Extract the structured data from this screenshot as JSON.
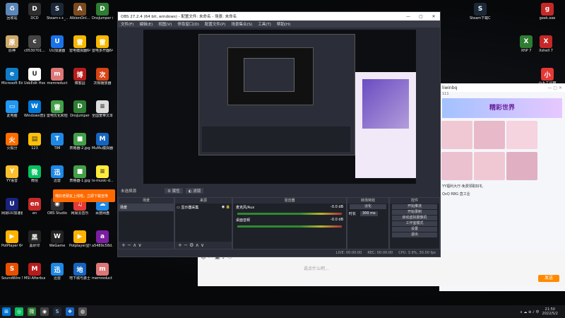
{
  "desktop_icons": [
    {
      "label": "回收站",
      "color": "#5b86b8",
      "glyph": "♻"
    },
    {
      "label": "DCD",
      "color": "#2e2e2e",
      "glyph": "D"
    },
    {
      "label": "Steam++_...",
      "color": "#1b2838",
      "glyph": "S"
    },
    {
      "label": "AlbionOnl...",
      "color": "#7a4a20",
      "glyph": "A"
    },
    {
      "label": "DnsJumper (2)7z",
      "color": "#2e7d32",
      "glyph": "D"
    },
    {
      "label": "原神",
      "color": "#cfa96a",
      "glyph": "原"
    },
    {
      "label": "c0530701...",
      "color": "#444",
      "glyph": "c"
    },
    {
      "label": "UU加速器",
      "color": "#1a73e8",
      "glyph": "U"
    },
    {
      "label": "雷电模拟器64",
      "color": "#f5b800",
      "glyph": "雷"
    },
    {
      "label": "雷电多开器64",
      "color": "#f5b800",
      "glyph": "雷"
    },
    {
      "label": "Microsoft Edge",
      "color": "#0f7cc9",
      "glyph": "e"
    },
    {
      "label": "UsbEdit Hosts Editor",
      "color": "#fff",
      "glyph": "U"
    },
    {
      "label": "memreduct",
      "color": "#d77",
      "glyph": "m"
    },
    {
      "label": "博客园",
      "color": "#b71c1c",
      "glyph": "博"
    },
    {
      "label": "次频播放器",
      "color": "#d84315",
      "glyph": "次"
    },
    {
      "label": "此电脑",
      "color": "#2196f3",
      "glyph": "▭"
    },
    {
      "label": "Windows普通网络调整",
      "color": "#0078d7",
      "glyph": "W"
    },
    {
      "label": "雷电优化和检测",
      "color": "#43a047",
      "glyph": "雷"
    },
    {
      "label": "DnsJumper",
      "color": "#2e7d32",
      "glyph": "D"
    },
    {
      "label": "全国宽带文本txt",
      "color": "#ddd",
      "glyph": "≡"
    },
    {
      "label": "火狐分",
      "color": "#ff6d00",
      "glyph": "火"
    },
    {
      "label": "123",
      "color": "#ffc107",
      "glyph": "▤"
    },
    {
      "label": "TIM",
      "color": "#1e88e5",
      "glyph": "T"
    },
    {
      "label": "表格器-2.jpg",
      "color": "#43a047",
      "glyph": "■"
    },
    {
      "label": "MuMu模拟器",
      "color": "#1565c0",
      "glyph": "M"
    },
    {
      "label": "YY语音",
      "color": "#fbc02d",
      "glyph": "Y"
    },
    {
      "label": "微信",
      "color": "#07c160",
      "glyph": "微"
    },
    {
      "label": "迅雷",
      "color": "#1e88e5",
      "glyph": "迅"
    },
    {
      "label": "表格器-1.jpg",
      "color": "#43a047",
      "glyph": "■"
    },
    {
      "label": "lx-music-d...",
      "color": "#ffeb3b",
      "glyph": "≡"
    },
    {
      "label": "网易UU加速器",
      "color": "#1a237e",
      "glyph": "U"
    },
    {
      "label": "en",
      "color": "#c62828",
      "glyph": "en"
    },
    {
      "label": "OBS Studio",
      "color": "#302e31",
      "glyph": "◉"
    },
    {
      "label": "网易云音乐",
      "color": "#e53935",
      "glyph": "♫"
    },
    {
      "label": "百度网盘",
      "color": "#1e88e5",
      "glyph": "☁"
    },
    {
      "label": "PotPlayer 64 bit",
      "color": "#ffb300",
      "glyph": "▶"
    },
    {
      "label": "黑砂印",
      "color": "#222",
      "glyph": "黑"
    },
    {
      "label": "WeGame",
      "color": "#222",
      "glyph": "W"
    },
    {
      "label": "Potplayer显电视直播",
      "color": "#ffb300",
      "glyph": "▶"
    },
    {
      "label": "a5489c58d...",
      "color": "#7b1fa2",
      "glyph": "a"
    },
    {
      "label": "SoundWire Server",
      "color": "#e65100",
      "glyph": "S"
    },
    {
      "label": "MSI Afterburner",
      "color": "#b71c1c",
      "glyph": "M"
    },
    {
      "label": "迅雷",
      "color": "#1e88e5",
      "glyph": "迅"
    },
    {
      "label": "地下城与勇士bit",
      "color": "#1565c0",
      "glyph": "地"
    },
    {
      "label": "memreduct (2)",
      "color": "#d77",
      "glyph": "m"
    }
  ],
  "right_icons": [
    {
      "label": "Steam下载CDN重定向",
      "color": "#1b2838",
      "glyph": "S"
    },
    {
      "label": "geek.exe",
      "color": "#c62828",
      "glyph": "g"
    },
    {
      "label": "XftP 7",
      "color": "#2e7d32",
      "glyph": "X"
    },
    {
      "label": "Xshell 7",
      "color": "#c62828",
      "glyph": "X"
    },
    {
      "label": "小九工具箱",
      "color": "#e53935",
      "glyph": "小"
    }
  ],
  "obs": {
    "title": "OBS 27.2.4 (64 bit, windows) - 配置文件: 未命名 - 场景: 未命名",
    "menu": [
      "文件(F)",
      "编辑(E)",
      "视图(V)",
      "停靠窗口(D)",
      "配置文件(P)",
      "场景集合(S)",
      "工具(T)",
      "帮助(H)"
    ],
    "no_source_label": "未选择源",
    "properties_btn": "属性",
    "filters_btn": "滤镜",
    "docks": {
      "scenes": {
        "title": "场景",
        "items": [
          "场景"
        ]
      },
      "sources": {
        "title": "来源",
        "items": [
          "显示器采集"
        ]
      },
      "mixer": {
        "title": "混音器",
        "tracks": [
          {
            "name": "麦克风/Aux",
            "db": "-0.0 dB"
          },
          {
            "name": "桌面音频",
            "db": "-0.0 dB"
          }
        ]
      },
      "transitions": {
        "title": "转场特效",
        "type": "淡化",
        "duration_label": "时长",
        "duration": "300 ms"
      },
      "controls": {
        "title": "控件",
        "buttons": [
          "开始推流",
          "开始录制",
          "启动虚拟摄像机",
          "工作室模式",
          "设置",
          "退出"
        ]
      }
    },
    "status": [
      "LIVE: 00:00:00",
      "REC: 00:00:00",
      "CPU: 3.9%, 30.00 fps"
    ]
  },
  "chat": {
    "user": "liwinbq",
    "count": "111",
    "banner": "YY福利大厅",
    "promo": "精彩世界",
    "item1": "YY福利大厅-免费领取好礼",
    "item2": "QxQ RBG 直工业",
    "input_placeholder": "说点什么吧...",
    "send_label": "发送"
  },
  "toast": "哦好老朋友上线啦，立即下载宣传",
  "taskbar": {
    "time": "21:50",
    "date": "2022/5/2",
    "apps": [
      "⊞",
      "◎",
      "微",
      "◉",
      "S",
      "❖",
      "◍"
    ]
  },
  "colors": {
    "obs_bg": "#2b2e38",
    "accent": "#ff6a00",
    "taskbar": "#16171b"
  }
}
